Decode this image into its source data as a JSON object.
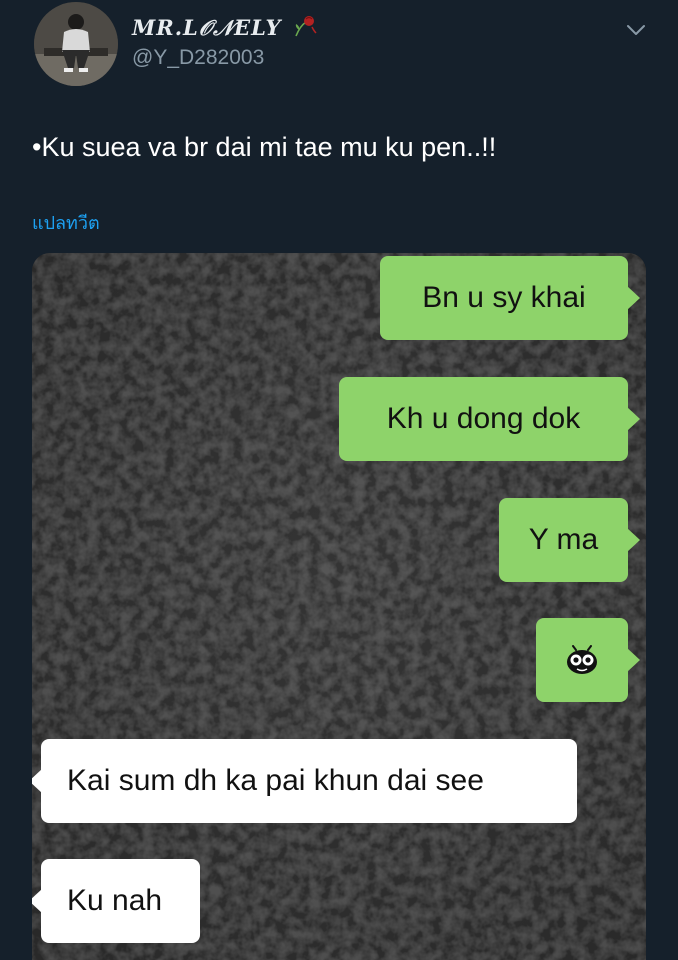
{
  "header": {
    "display_name": "MR.L𝒪𝒩ELY",
    "handle": "@Y_D282003"
  },
  "tweet": {
    "text": "•Ku suea va br dai mi tae mu ku pen..!!",
    "translate_label": "แปลทวีต"
  },
  "icons": {
    "avatar": "profile-photo",
    "name_decoration": "wilted-rose-icon",
    "menu": "chevron-down-icon",
    "sticker": "bug-eyed-emoji-icon"
  },
  "chat": {
    "messages": [
      {
        "side": "sent",
        "text": "Bn u sy khai"
      },
      {
        "side": "sent",
        "text": "Kh u dong dok"
      },
      {
        "side": "sent",
        "text": "Y ma"
      },
      {
        "side": "sent",
        "text": ""
      },
      {
        "side": "received",
        "text": "Kai sum dh ka pai khun dai see"
      },
      {
        "side": "received",
        "text": "Ku nah"
      }
    ]
  },
  "colors": {
    "background": "#15202b",
    "link": "#1da1f2",
    "sent_bubble": "#8ed36a",
    "received_bubble": "#ffffff",
    "muted_text": "#8899a6"
  }
}
